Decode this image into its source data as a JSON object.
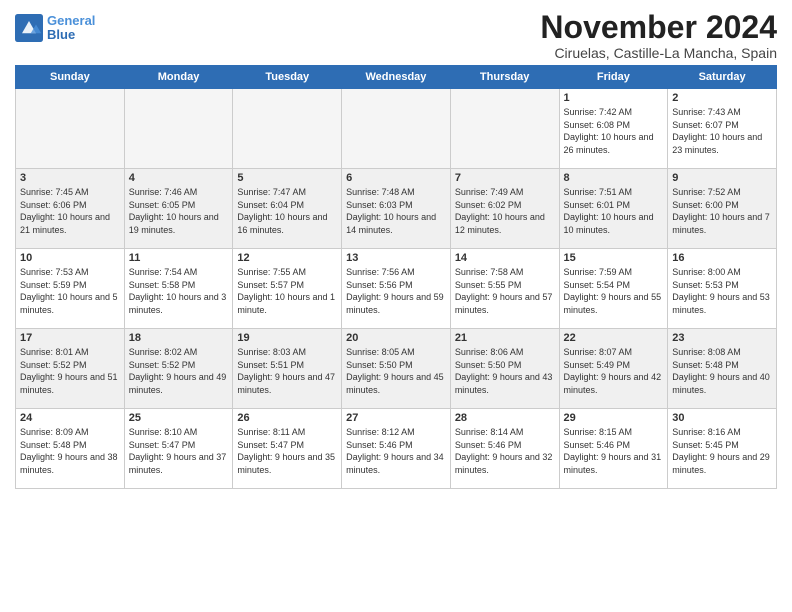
{
  "header": {
    "logo_line1": "General",
    "logo_line2": "Blue",
    "month": "November 2024",
    "location": "Ciruelas, Castille-La Mancha, Spain"
  },
  "weekdays": [
    "Sunday",
    "Monday",
    "Tuesday",
    "Wednesday",
    "Thursday",
    "Friday",
    "Saturday"
  ],
  "weeks": [
    [
      {
        "day": "",
        "info": ""
      },
      {
        "day": "",
        "info": ""
      },
      {
        "day": "",
        "info": ""
      },
      {
        "day": "",
        "info": ""
      },
      {
        "day": "",
        "info": ""
      },
      {
        "day": "1",
        "info": "Sunrise: 7:42 AM\nSunset: 6:08 PM\nDaylight: 10 hours and 26 minutes."
      },
      {
        "day": "2",
        "info": "Sunrise: 7:43 AM\nSunset: 6:07 PM\nDaylight: 10 hours and 23 minutes."
      }
    ],
    [
      {
        "day": "3",
        "info": "Sunrise: 7:45 AM\nSunset: 6:06 PM\nDaylight: 10 hours and 21 minutes."
      },
      {
        "day": "4",
        "info": "Sunrise: 7:46 AM\nSunset: 6:05 PM\nDaylight: 10 hours and 19 minutes."
      },
      {
        "day": "5",
        "info": "Sunrise: 7:47 AM\nSunset: 6:04 PM\nDaylight: 10 hours and 16 minutes."
      },
      {
        "day": "6",
        "info": "Sunrise: 7:48 AM\nSunset: 6:03 PM\nDaylight: 10 hours and 14 minutes."
      },
      {
        "day": "7",
        "info": "Sunrise: 7:49 AM\nSunset: 6:02 PM\nDaylight: 10 hours and 12 minutes."
      },
      {
        "day": "8",
        "info": "Sunrise: 7:51 AM\nSunset: 6:01 PM\nDaylight: 10 hours and 10 minutes."
      },
      {
        "day": "9",
        "info": "Sunrise: 7:52 AM\nSunset: 6:00 PM\nDaylight: 10 hours and 7 minutes."
      }
    ],
    [
      {
        "day": "10",
        "info": "Sunrise: 7:53 AM\nSunset: 5:59 PM\nDaylight: 10 hours and 5 minutes."
      },
      {
        "day": "11",
        "info": "Sunrise: 7:54 AM\nSunset: 5:58 PM\nDaylight: 10 hours and 3 minutes."
      },
      {
        "day": "12",
        "info": "Sunrise: 7:55 AM\nSunset: 5:57 PM\nDaylight: 10 hours and 1 minute."
      },
      {
        "day": "13",
        "info": "Sunrise: 7:56 AM\nSunset: 5:56 PM\nDaylight: 9 hours and 59 minutes."
      },
      {
        "day": "14",
        "info": "Sunrise: 7:58 AM\nSunset: 5:55 PM\nDaylight: 9 hours and 57 minutes."
      },
      {
        "day": "15",
        "info": "Sunrise: 7:59 AM\nSunset: 5:54 PM\nDaylight: 9 hours and 55 minutes."
      },
      {
        "day": "16",
        "info": "Sunrise: 8:00 AM\nSunset: 5:53 PM\nDaylight: 9 hours and 53 minutes."
      }
    ],
    [
      {
        "day": "17",
        "info": "Sunrise: 8:01 AM\nSunset: 5:52 PM\nDaylight: 9 hours and 51 minutes."
      },
      {
        "day": "18",
        "info": "Sunrise: 8:02 AM\nSunset: 5:52 PM\nDaylight: 9 hours and 49 minutes."
      },
      {
        "day": "19",
        "info": "Sunrise: 8:03 AM\nSunset: 5:51 PM\nDaylight: 9 hours and 47 minutes."
      },
      {
        "day": "20",
        "info": "Sunrise: 8:05 AM\nSunset: 5:50 PM\nDaylight: 9 hours and 45 minutes."
      },
      {
        "day": "21",
        "info": "Sunrise: 8:06 AM\nSunset: 5:50 PM\nDaylight: 9 hours and 43 minutes."
      },
      {
        "day": "22",
        "info": "Sunrise: 8:07 AM\nSunset: 5:49 PM\nDaylight: 9 hours and 42 minutes."
      },
      {
        "day": "23",
        "info": "Sunrise: 8:08 AM\nSunset: 5:48 PM\nDaylight: 9 hours and 40 minutes."
      }
    ],
    [
      {
        "day": "24",
        "info": "Sunrise: 8:09 AM\nSunset: 5:48 PM\nDaylight: 9 hours and 38 minutes."
      },
      {
        "day": "25",
        "info": "Sunrise: 8:10 AM\nSunset: 5:47 PM\nDaylight: 9 hours and 37 minutes."
      },
      {
        "day": "26",
        "info": "Sunrise: 8:11 AM\nSunset: 5:47 PM\nDaylight: 9 hours and 35 minutes."
      },
      {
        "day": "27",
        "info": "Sunrise: 8:12 AM\nSunset: 5:46 PM\nDaylight: 9 hours and 34 minutes."
      },
      {
        "day": "28",
        "info": "Sunrise: 8:14 AM\nSunset: 5:46 PM\nDaylight: 9 hours and 32 minutes."
      },
      {
        "day": "29",
        "info": "Sunrise: 8:15 AM\nSunset: 5:46 PM\nDaylight: 9 hours and 31 minutes."
      },
      {
        "day": "30",
        "info": "Sunrise: 8:16 AM\nSunset: 5:45 PM\nDaylight: 9 hours and 29 minutes."
      }
    ]
  ]
}
